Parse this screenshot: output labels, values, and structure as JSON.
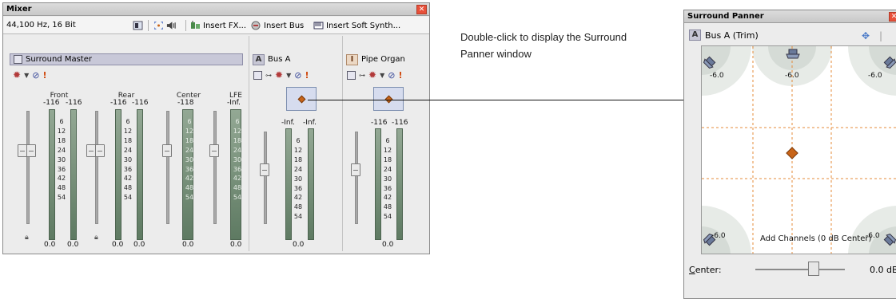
{
  "mixer": {
    "title": "Mixer",
    "format": "44,100 Hz, 16 Bit",
    "toolbar": {
      "insert_fx": "Insert FX...",
      "insert_bus": "Insert Bus",
      "insert_soft_synth": "Insert Soft Synth..."
    },
    "master": {
      "name": "Surround Master",
      "groups": [
        {
          "label": "Front",
          "peaks": [
            "-116",
            "-116"
          ],
          "values": [
            "0.0",
            "0.0"
          ]
        },
        {
          "label": "Rear",
          "peaks": [
            "-116",
            "-116"
          ],
          "values": [
            "0.0",
            "0.0"
          ]
        },
        {
          "label": "Center",
          "peaks": [
            "-118"
          ],
          "values": [
            "0.0"
          ]
        },
        {
          "label": "LFE",
          "peaks": [
            "-Inf."
          ],
          "values": [
            "0.0"
          ]
        }
      ]
    },
    "bus": {
      "name": "Bus A",
      "peaks": [
        "-Inf.",
        "-Inf."
      ],
      "value": "0.0"
    },
    "organ": {
      "name": "Pipe Organ",
      "peaks": [
        "-116",
        "-116"
      ],
      "value": "0.0"
    },
    "scale": [
      "6",
      "12",
      "18",
      "24",
      "30",
      "36",
      "42",
      "48",
      "54"
    ]
  },
  "callout": {
    "text": "Double-click to display the Surround Panner window"
  },
  "panner": {
    "title": "Surround Panner",
    "bus_label": "Bus A (Trim)",
    "speaker_levels": {
      "front_left": "-6.0",
      "front_center": "-6.0",
      "front_right": "-6.0",
      "rear_left": "-6.0",
      "rear_right": "-6.0"
    },
    "add_channels": "Add Channels (0 dB Center)",
    "center_label_underlined": "C",
    "center_label_rest": "enter:",
    "center_value": "0.0 dB"
  }
}
